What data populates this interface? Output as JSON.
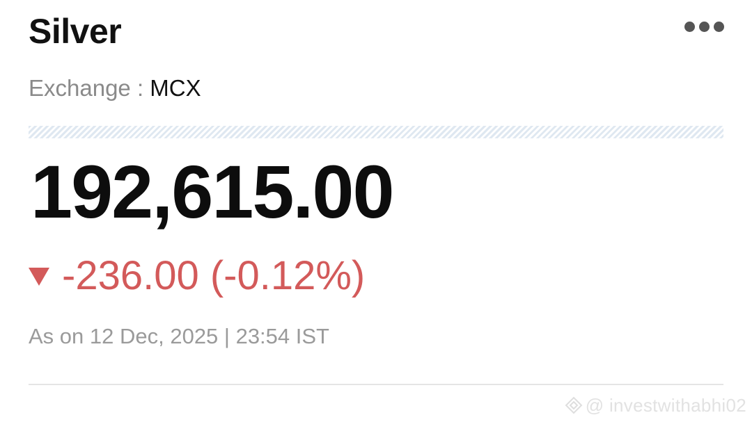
{
  "header": {
    "title": "Silver",
    "more_icon": "more-horizontal-icon"
  },
  "exchange": {
    "label": "Exchange : ",
    "value": "MCX"
  },
  "quote": {
    "price": "192,615.00",
    "change": "-236.00 (-0.12%)",
    "direction_icon": "triangle-down-icon",
    "as_on": "As on 12 Dec, 2025 | 23:54 IST"
  },
  "watermark": {
    "text": "@ investwithabhi02"
  },
  "colors": {
    "negative": "#d35a5a",
    "title": "#111111",
    "muted": "#8a8a8a",
    "hatch": "#dfe8f1"
  }
}
